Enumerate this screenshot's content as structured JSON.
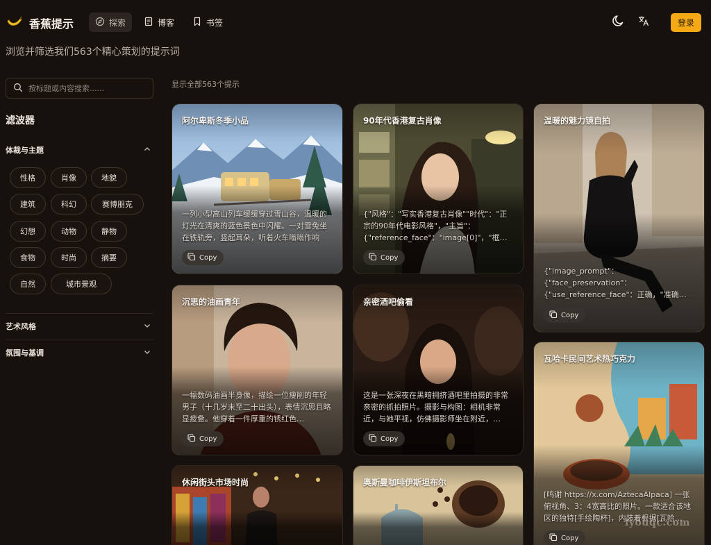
{
  "header": {
    "logo_text": "香蕉提示",
    "nav": [
      {
        "label": "探索",
        "icon": "compass-icon"
      },
      {
        "label": "博客",
        "icon": "document-icon"
      },
      {
        "label": "书签",
        "icon": "bookmark-icon"
      }
    ],
    "login_label": "登录",
    "theme_icon": "moon-icon",
    "language_icon": "translate-icon",
    "accent_color": "#f5a914"
  },
  "subtitle": "浏览并筛选我们563个精心策划的提示词",
  "sidebar": {
    "search_placeholder": "按标题或内容搜索......",
    "filter_title": "滤波器",
    "sections": [
      {
        "label": "体裁与主题",
        "expanded": true,
        "tags": [
          "性格",
          "肖像",
          "地貌",
          "建筑",
          "科幻",
          "赛博朋克",
          "幻想",
          "动物",
          "静物",
          "食物",
          "时尚",
          "摘要",
          "自然",
          "城市景观"
        ]
      },
      {
        "label": "艺术风格",
        "expanded": false
      },
      {
        "label": "氛围与基调",
        "expanded": false
      }
    ]
  },
  "main": {
    "count_text": "显示全部563个提示",
    "copy_label": "Copy",
    "cards": [
      {
        "title": "阿尔卑斯冬季小品",
        "desc": "一列小型高山列车缓缓穿过雪山谷，温暖的灯光在清爽的蓝色景色中闪耀。一对雪兔坐在铁轨旁，竖起耳朵，听着火车嗡嗡作响"
      },
      {
        "title": "90年代香港复古肖像",
        "desc": "{\"风格\"：\"写实香港复古肖像\"\"时代\"：\"正宗的90年代电影风格\"，\"主旨\"：{\"reference_face\"：\"image[0]\"，\"框架\"…"
      },
      {
        "title": "温暖的魅力镜自拍",
        "desc": "{\"image_prompt\"：{\"face_preservation\"：{\"use_reference_face\"：正确，\"准确…"
      },
      {
        "title": "沉思的油画青年",
        "desc": "一幅数码油画半身像，描绘一位瘦削的年轻男子（十几岁末至二十出头），表情沉思且略显疲惫。他穿着一件厚重的锈红色…"
      },
      {
        "title": "亲密酒吧偷看",
        "desc": "这是一张深夜在黑暗拥挤酒吧里拍摄的非常亲密的抓拍照片。摄影与构图：相机非常近，与她平视，仿佛摄影师坐在附近，…"
      },
      {
        "title": "瓦哈卡民间艺术热巧克力",
        "desc": "[鸣谢 https://x.com/AztecaAlpaca] 一张俯视角、3：4宽高比的照片。一款适合该地区的独特[手绘陶杯]，内装着根据[瓦哈…"
      },
      {
        "title": "休闲街头市场时尚",
        "desc": ""
      },
      {
        "title": "奥斯曼咖啡伊斯坦布尔",
        "desc": ""
      }
    ]
  },
  "watermark": "iyouqc.com"
}
